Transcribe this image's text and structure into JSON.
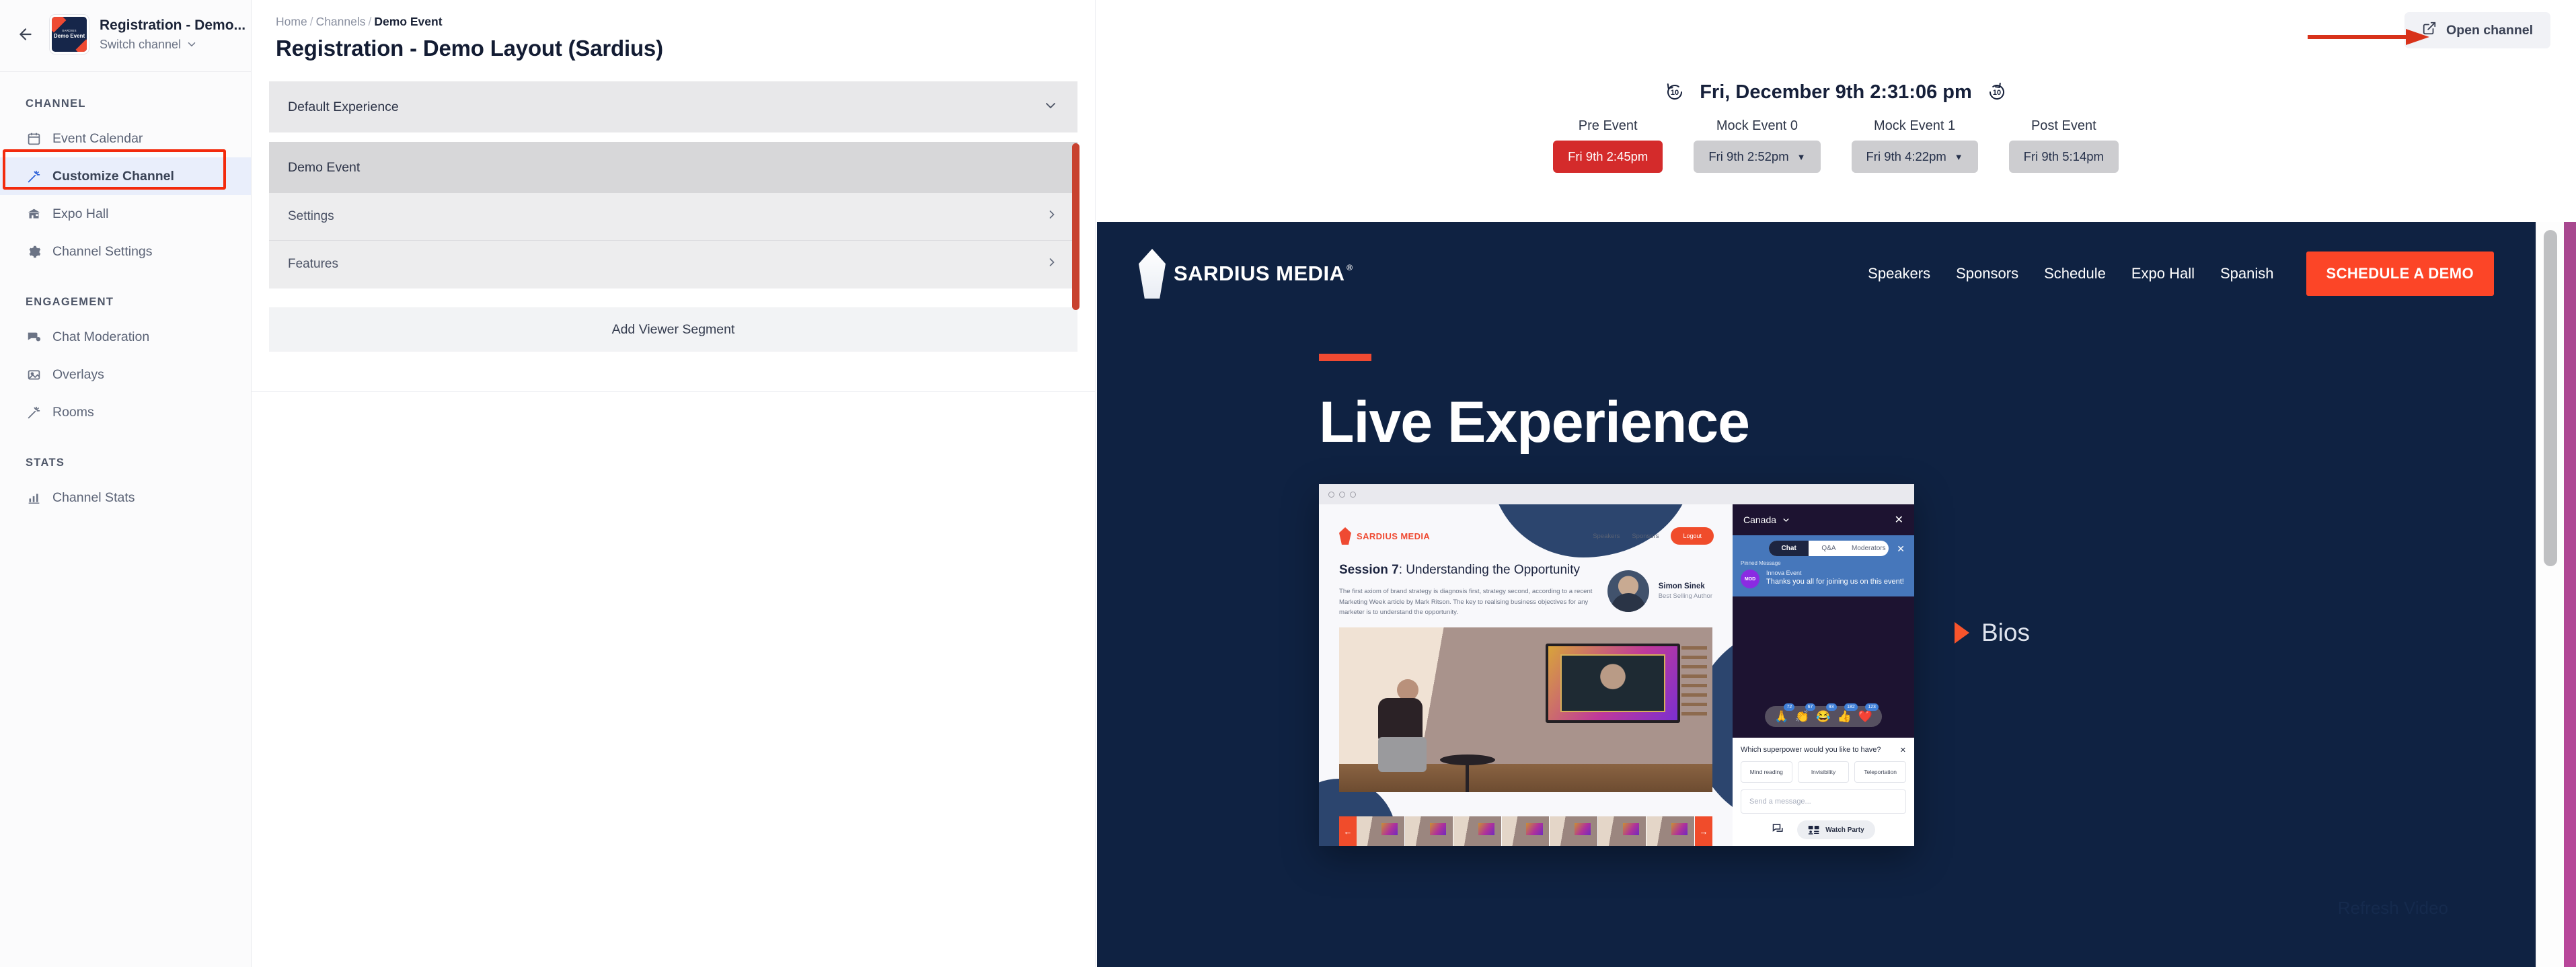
{
  "sidebar": {
    "channel_name": "Registration - Demo...",
    "switch_label": "Switch channel",
    "thumb_brand": "SARDIUS",
    "thumb_title": "Demo Event",
    "sections": [
      {
        "label": "CHANNEL",
        "items": [
          {
            "label": "Event Calendar",
            "icon": "calendar-icon",
            "active": false
          },
          {
            "label": "Customize Channel",
            "icon": "magic-wand-icon",
            "active": true
          },
          {
            "label": "Expo Hall",
            "icon": "expo-hall-icon",
            "active": false
          },
          {
            "label": "Channel Settings",
            "icon": "gear-icon",
            "active": false
          }
        ]
      },
      {
        "label": "ENGAGEMENT",
        "items": [
          {
            "label": "Chat Moderation",
            "icon": "chat-bubbles-icon",
            "active": false
          },
          {
            "label": "Overlays",
            "icon": "image-icon",
            "active": false
          },
          {
            "label": "Rooms",
            "icon": "magic-wand-icon",
            "active": false
          }
        ]
      },
      {
        "label": "STATS",
        "items": [
          {
            "label": "Channel Stats",
            "icon": "bar-chart-icon",
            "active": false
          }
        ]
      }
    ]
  },
  "breadcrumb": {
    "home": "Home",
    "channels": "Channels",
    "current": "Demo Event",
    "separator": "/"
  },
  "page_title": "Registration - Demo Layout (Sardius)",
  "experience": {
    "selected": "Default Experience",
    "segment_title": "Demo Event",
    "rows": [
      {
        "label": "Settings"
      },
      {
        "label": "Features"
      }
    ],
    "add_segment": "Add Viewer Segment"
  },
  "toolbar": {
    "open_channel": "Open channel"
  },
  "clock": {
    "datetime": "Fri, December 9th 2:31:06 pm",
    "rewind_label": "10",
    "forward_label": "10"
  },
  "stages": [
    {
      "label": "Pre Event",
      "time": "Fri 9th 2:45pm",
      "active": true,
      "has_caret": false
    },
    {
      "label": "Mock Event 0",
      "time": "Fri 9th 2:52pm",
      "active": false,
      "has_caret": true
    },
    {
      "label": "Mock Event 1",
      "time": "Fri 9th 4:22pm",
      "active": false,
      "has_caret": true
    },
    {
      "label": "Post Event",
      "time": "Fri 9th 5:14pm",
      "active": false,
      "has_caret": false
    }
  ],
  "preview": {
    "brand": "SARDIUS MEDIA",
    "brand_sup": "®",
    "nav_links": [
      "Speakers",
      "Sponsors",
      "Schedule",
      "Expo Hall",
      "Spanish"
    ],
    "cta": "SCHEDULE A DEMO",
    "hero_title": "Live Experience",
    "bios_label": "Bios",
    "refresh_video": "Refresh Video",
    "mockup": {
      "brand": "SARDIUS MEDIA",
      "nav_links": [
        "Speakers",
        "Sponsors"
      ],
      "logout": "Logout",
      "session_prefix": "Session 7",
      "session_rest": ": Understanding the Opportunity",
      "session_body": "The first axiom of brand strategy is diagnosis first, strategy second, according to a recent Marketing Week article by Mark Ritson. The key to realising business objectives for any marketer is to understand the opportunity.",
      "speaker_name": "Simon Sinek",
      "speaker_role": "Best Selling Author",
      "chat": {
        "country": "Canada",
        "close": "✕",
        "tabs": [
          "Chat",
          "Q&A",
          "Moderators"
        ],
        "active_tab": "Chat",
        "pinned_label": "Pinned Message",
        "pinned_badge": "MOD",
        "pinned_author": "Innova Event",
        "pinned_message": "Thanks you all for joining us on this event!",
        "reactions": [
          {
            "emoji": "🙏",
            "count": "72"
          },
          {
            "emoji": "👏",
            "count": "67"
          },
          {
            "emoji": "😂",
            "count": "93"
          },
          {
            "emoji": "👍",
            "count": "182"
          },
          {
            "emoji": "❤️",
            "count": "123"
          }
        ],
        "poll_question": "Which superpower would you like to have?",
        "poll_options": [
          "Mind reading",
          "Invisibility",
          "Teleportation"
        ],
        "input_placeholder": "Send a message...",
        "watch_party": "Watch Party"
      }
    }
  },
  "colors": {
    "accent_red": "#ef4a32",
    "cta_orange": "#fc4527",
    "navy": "#0f2242",
    "active_blue": "#2f62d8",
    "stage_active": "#d42b2b",
    "annotation_red": "#f32a0c"
  }
}
